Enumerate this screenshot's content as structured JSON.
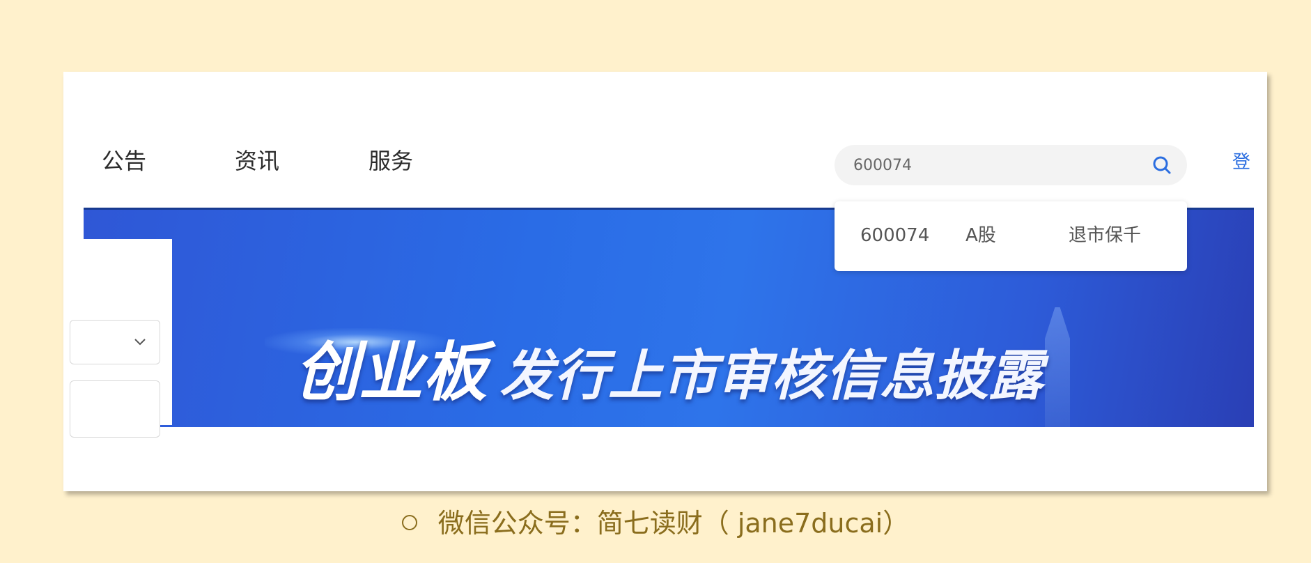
{
  "nav": {
    "items": [
      {
        "label": "公告"
      },
      {
        "label": "资讯"
      },
      {
        "label": "服务"
      }
    ],
    "login_label": "登"
  },
  "search": {
    "value": "600074",
    "icon": "search-icon",
    "suggestions": [
      {
        "code": "600074",
        "market": "A股",
        "name": "退市保千"
      }
    ]
  },
  "banner": {
    "title_main": "创业板",
    "title_sub": "发行上市审核信息披露"
  },
  "caption": {
    "text": "微信公众号：简七读财（ jane7ducai）"
  },
  "colors": {
    "page_bg": "#fff1cc",
    "accent_blue": "#2a6de0",
    "banner_blue": "#2a6ce6",
    "caption_text": "#8a6d1d"
  }
}
